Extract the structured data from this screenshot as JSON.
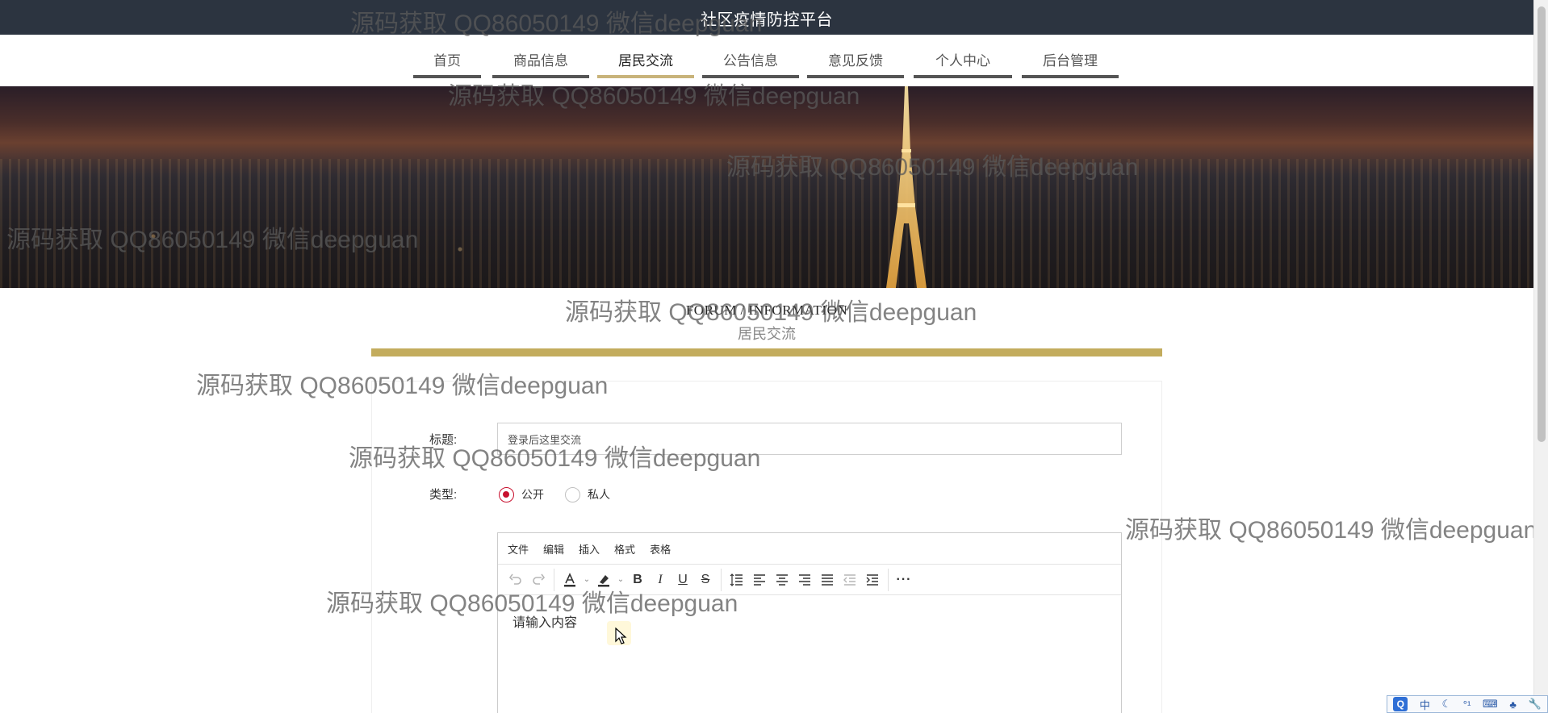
{
  "header": {
    "title": "社区疫情防控平台"
  },
  "nav": {
    "items": [
      {
        "label": "首页"
      },
      {
        "label": "商品信息"
      },
      {
        "label": "居民交流"
      },
      {
        "label": "公告信息"
      },
      {
        "label": "意见反馈"
      },
      {
        "label": "个人中心"
      },
      {
        "label": "后台管理"
      }
    ],
    "active_index": 2
  },
  "section": {
    "title_en": "FORUM / INFORMATION",
    "title_cn": "居民交流"
  },
  "form": {
    "title_label": "标题:",
    "title_placeholder": "登录后这里交流",
    "type_label": "类型:",
    "type_options": [
      {
        "label": "公开",
        "checked": true
      },
      {
        "label": "私人",
        "checked": false
      }
    ]
  },
  "editor": {
    "menus": [
      "文件",
      "编辑",
      "插入",
      "格式",
      "表格"
    ],
    "placeholder": "请输入内容"
  },
  "watermark": {
    "text": "源码获取 QQ86050149 微信deepguan"
  },
  "ime": {
    "lang": "中"
  },
  "colors": {
    "topbar": "#2c3440",
    "accent_gold": "#c3ac5d",
    "radio_checked": "#c8102e"
  }
}
